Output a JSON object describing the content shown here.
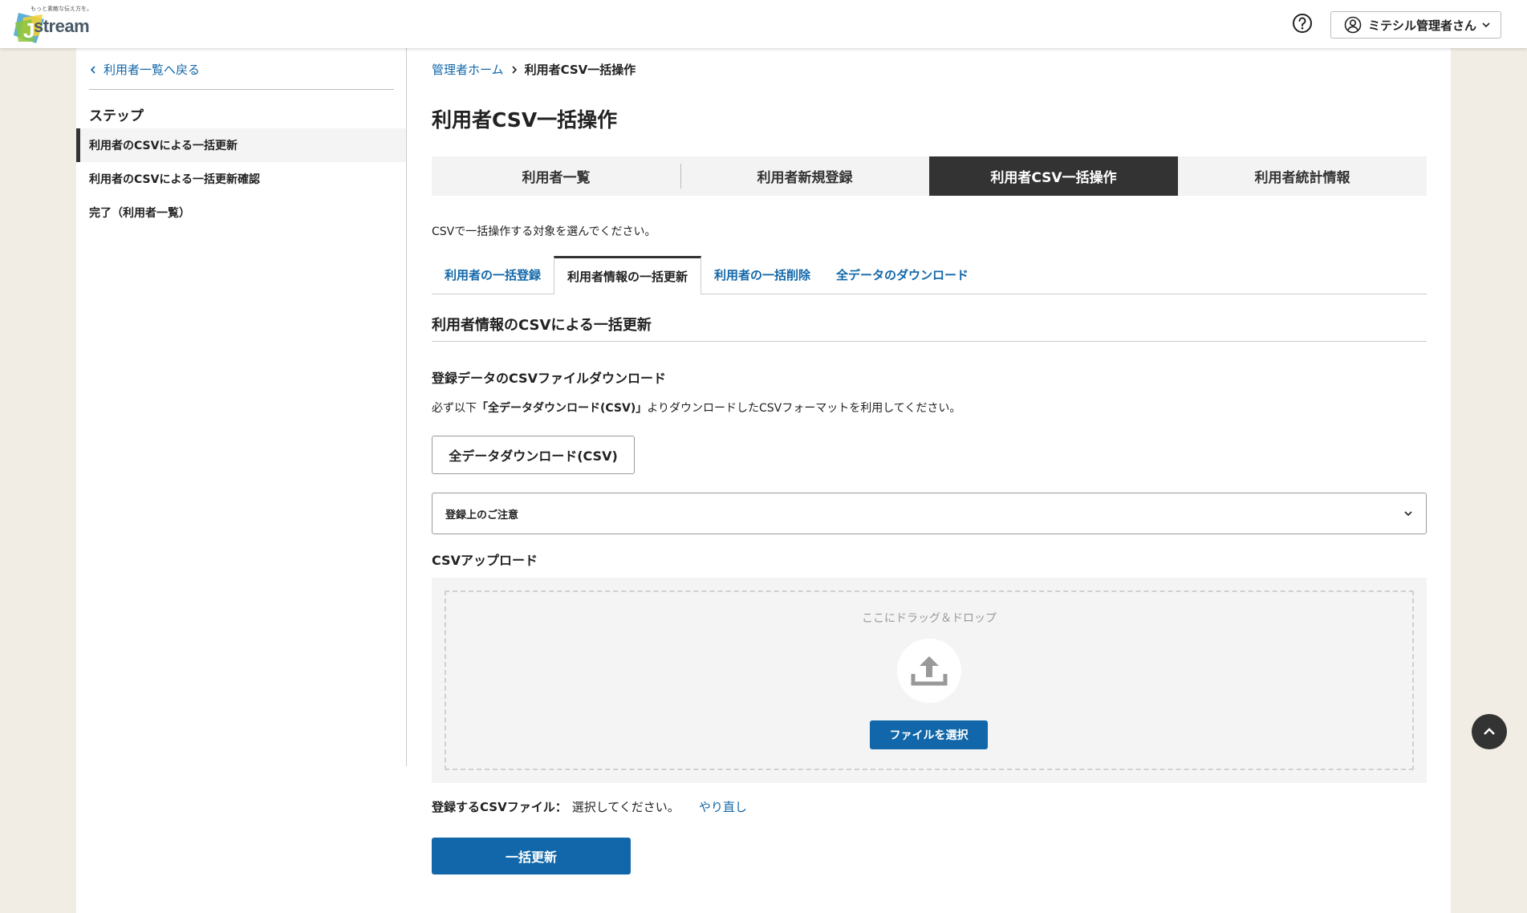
{
  "header": {
    "logo_tagline": "もっと素敵な伝え方を。",
    "logo_text": "stream",
    "logo_mark_letter": "J",
    "help_icon": "question-circle-icon",
    "user_name": "ミテシル管理者さん"
  },
  "sidebar": {
    "back_label": "利用者一覧へ戻る",
    "steps_heading": "ステップ",
    "steps": [
      {
        "label": "利用者のCSVによる一括更新",
        "active": true
      },
      {
        "label": "利用者のCSVによる一括更新確認",
        "active": false
      },
      {
        "label": "完了（利用者一覧）",
        "active": false
      }
    ]
  },
  "breadcrumb": {
    "home": "管理者ホーム",
    "current": "利用者CSV一括操作"
  },
  "page_title": "利用者CSV一括操作",
  "main_tabs": [
    {
      "label": "利用者一覧",
      "active": false
    },
    {
      "label": "利用者新規登録",
      "active": false
    },
    {
      "label": "利用者CSV一括操作",
      "active": true
    },
    {
      "label": "利用者統計情報",
      "active": false
    }
  ],
  "intro_text": "CSVで一括操作する対象を選んでください。",
  "sub_tabs": [
    {
      "label": "利用者の一括登録",
      "active": false
    },
    {
      "label": "利用者情報の一括更新",
      "active": true
    },
    {
      "label": "利用者の一括削除",
      "active": false
    },
    {
      "label": "全データのダウンロード",
      "active": false
    }
  ],
  "section_title": "利用者情報のCSVによる一括更新",
  "download": {
    "heading": "登録データのCSVファイルダウンロード",
    "desc_prefix": "必ず以下",
    "desc_bold": "「全データダウンロード(CSV)」",
    "desc_suffix": "よりダウンロードしたCSVフォーマットを利用してください。",
    "button_label": "全データダウンロード(CSV)"
  },
  "notice_accordion": {
    "label": "登録上のご注意"
  },
  "upload": {
    "heading": "CSVアップロード",
    "drop_text": "ここにドラッグ＆ドロップ",
    "select_button": "ファイルを選択"
  },
  "file_status": {
    "label": "登録するCSVファイル：",
    "value": "選択してください。",
    "reset_label": "やり直し"
  },
  "submit_label": "一括更新",
  "colors": {
    "link": "#1167a9",
    "primary": "#1167a9",
    "tab_active_bg": "#333333",
    "page_bg": "#f2ede4"
  }
}
